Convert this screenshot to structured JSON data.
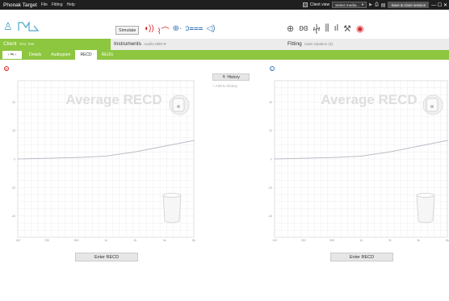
{
  "titlebar": {
    "app_title": "Phonak Target",
    "menu": [
      "File",
      "Fitting",
      "Help"
    ],
    "client_view": "Client view",
    "select_media": "Select media...",
    "save_close": "Save & close session",
    "window_controls": "— ☐ ✕"
  },
  "toolbar": {
    "simulate": "Simulate"
  },
  "info": {
    "client_title": "Client",
    "client_sub": "Test, Test",
    "instruments_title": "Instruments",
    "instruments_sub": "Audéo M90-R",
    "fitting_title": "Fitting",
    "fitting_sub": "Calm situation (3)"
  },
  "nav": {
    "back": "‹ ⇆ ›",
    "tabs": [
      {
        "label": "Details",
        "active": false
      },
      {
        "label": "Audiogram",
        "active": false
      },
      {
        "label": "RECD",
        "active": true
      },
      {
        "label": "REUG",
        "active": false
      }
    ]
  },
  "panels": {
    "right_badge": "R",
    "left_badge": "L",
    "history": "History",
    "add_to_history": "+ Add to history",
    "enter_recd": "Enter RECD"
  },
  "chart_data": [
    {
      "type": "line",
      "side": "right",
      "title": "Average RECD",
      "x": [
        "125",
        "250",
        "500",
        "1k",
        "2k",
        "4k",
        "8k"
      ],
      "y_ticks": [
        40,
        20,
        0,
        -20,
        -40
      ],
      "ylim": [
        -55,
        55
      ],
      "grid": true,
      "series": [
        {
          "values": [
            0,
            0.5,
            1,
            2,
            5,
            9,
            13
          ]
        }
      ]
    },
    {
      "type": "line",
      "side": "left",
      "title": "Average RECD",
      "x": [
        "125",
        "250",
        "500",
        "1k",
        "2k",
        "4k",
        "8k"
      ],
      "y_ticks": [
        40,
        20,
        0,
        -20,
        -40
      ],
      "ylim": [
        -55,
        55
      ],
      "grid": true,
      "series": [
        {
          "values": [
            0,
            0.5,
            1,
            2,
            5,
            9,
            13
          ]
        }
      ]
    }
  ],
  "colors": {
    "brand_green": "#8dc63f",
    "right_red": "#d9262a",
    "left_blue": "#3a78b8",
    "curve": "#b8bec6"
  }
}
